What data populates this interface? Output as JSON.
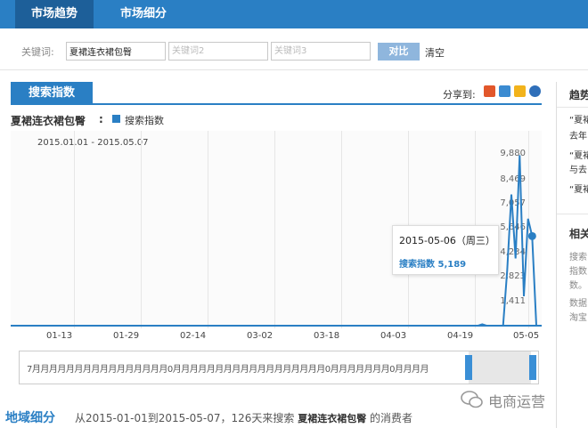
{
  "nav": {
    "tabs": [
      "市场趋势",
      "市场细分"
    ]
  },
  "keywords": {
    "label": "关键词:",
    "values": [
      "夏裙连衣裙包臀"
    ],
    "placeholders": [
      "关键词2",
      "关键词3"
    ],
    "compare_label": "对比",
    "clear_label": "清空"
  },
  "panel": {
    "tab_label": "搜索指数",
    "share_label": "分享到:",
    "share_icons": [
      "share-icon-1",
      "share-icon-2",
      "share-icon-3",
      "share-icon-4"
    ]
  },
  "chart_data": {
    "type": "line",
    "title": "夏裙连衣裙包臀",
    "date_range": "2015.01.01 - 2015.05.07",
    "series": [
      {
        "name": "搜索指数",
        "color": "#2a7fc4",
        "points": [
          [
            "2015-01-01",
            0
          ],
          [
            "2015-04-23",
            0
          ],
          [
            "2015-04-24",
            80
          ],
          [
            "2015-04-25",
            0
          ],
          [
            "2015-04-29",
            0
          ],
          [
            "2015-04-30",
            3200
          ],
          [
            "2015-05-01",
            7600
          ],
          [
            "2015-05-02",
            3900
          ],
          [
            "2015-05-03",
            9880
          ],
          [
            "2015-05-04",
            1700
          ],
          [
            "2015-05-05",
            6200
          ],
          [
            "2015-05-06",
            5189
          ],
          [
            "2015-05-07",
            0
          ]
        ]
      }
    ],
    "yticks": [
      "9,880",
      "8,469",
      "7,057",
      "5,646",
      "4,234",
      "2,823",
      "1,411"
    ],
    "ylim": [
      0,
      11292
    ],
    "xticks": [
      "01-13",
      "01-29",
      "02-14",
      "03-02",
      "03-18",
      "04-03",
      "04-19",
      "05-05"
    ],
    "tooltip": {
      "date": "2015-05-06（周三）",
      "label": "搜索指数",
      "value": "5,189"
    }
  },
  "navigator": {
    "strip_text": "7月月月月月月月月月月月月月月月月0月月月月月月月月月月月月月月月月月月0月月月月月月月0月月月月"
  },
  "bottom": {
    "region_title": "地域细分",
    "desc_prefix": "从2015-01-01到2015-05-07，126天来搜索",
    "keyword": "夏裙连衣裙包臀",
    "desc_suffix": "的消费者",
    "watermark": "电商运营"
  },
  "sidebar": {
    "title1": "趋势",
    "quotes": [
      "“夏裙",
      "去年",
      "“夏裙",
      "与去",
      "“夏裙"
    ],
    "title2": "相关",
    "lines": [
      "搜索",
      "指数",
      "数。",
      "数据",
      "淘宝"
    ]
  }
}
